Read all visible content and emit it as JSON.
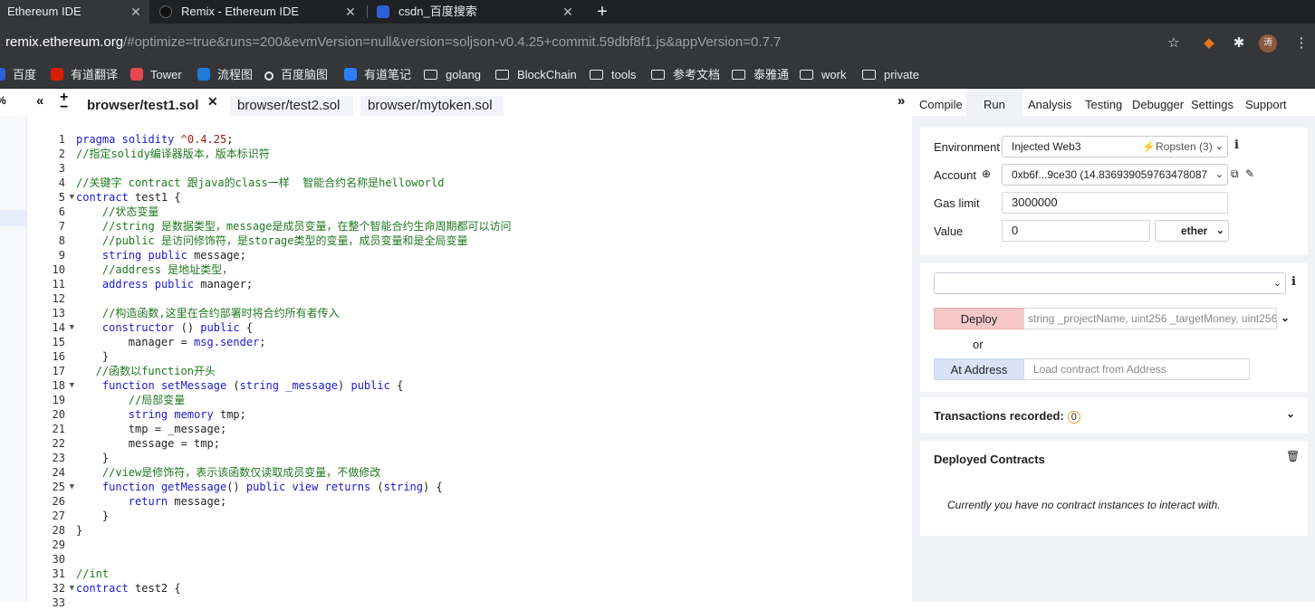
{
  "browser": {
    "tabs": [
      {
        "title": "Ethereum IDE",
        "close": "✕"
      },
      {
        "title": "Remix - Ethereum IDE",
        "close": "✕"
      },
      {
        "title": "csdn_百度搜索",
        "close": "✕"
      }
    ],
    "new_tab": "+",
    "url_host": "remix.ethereum.org",
    "url_rest": "/#optimize=true&runs=200&evmVersion=null&version=soljson-v0.4.25+commit.59dbf8f1.js&appVersion=0.7.7",
    "avatar_text": "涛",
    "bookmarks": [
      "百度",
      "有道翻译",
      "Tower",
      "流程图",
      "百度脑图",
      "有道笔记",
      "golang",
      "BlockChain",
      "tools",
      "参考文档",
      "泰雅通",
      "work",
      "private"
    ]
  },
  "editor": {
    "tabs": [
      "browser/test1.sol",
      "browser/test2.sol",
      "browser/mytoken.sol"
    ],
    "tab_close": "✕",
    "toolbar": {
      "collapse": "«",
      "zoom_in": "+",
      "zoom_out": "−",
      "expand": "»"
    },
    "line_numbers": [
      "1",
      "2",
      "3",
      "4",
      "5",
      "6",
      "7",
      "8",
      "9",
      "10",
      "11",
      "12",
      "13",
      "14",
      "15",
      "16",
      "17",
      "18",
      "19",
      "20",
      "21",
      "22",
      "23",
      "24",
      "25",
      "26",
      "27",
      "28",
      "29",
      "30",
      "31",
      "32",
      "33"
    ]
  },
  "run_panel": {
    "nav_tabs": [
      "Compile",
      "Run",
      "Analysis",
      "Testing",
      "Debugger",
      "Settings",
      "Support"
    ],
    "environment_label": "Environment",
    "environment_value": "Injected Web3",
    "network": "Ropsten (3)",
    "account_label": "Account",
    "account_value": "0xb6f...9ce30 (14.836939059763478087",
    "gas_limit_label": "Gas limit",
    "gas_limit_value": "3000000",
    "value_label": "Value",
    "value_amount": "0",
    "value_unit": "ether",
    "deploy_label": "Deploy",
    "deploy_args_placeholder": "string _projectName, uint256 _targetMoney, uint256",
    "or_text": "or",
    "at_address_label": "At Address",
    "at_address_placeholder": "Load contract from Address",
    "transactions_label": "Transactions recorded:",
    "transactions_count": "0",
    "deployed_label": "Deployed Contracts",
    "no_instances": "Currently you have no contract instances to interact with."
  }
}
